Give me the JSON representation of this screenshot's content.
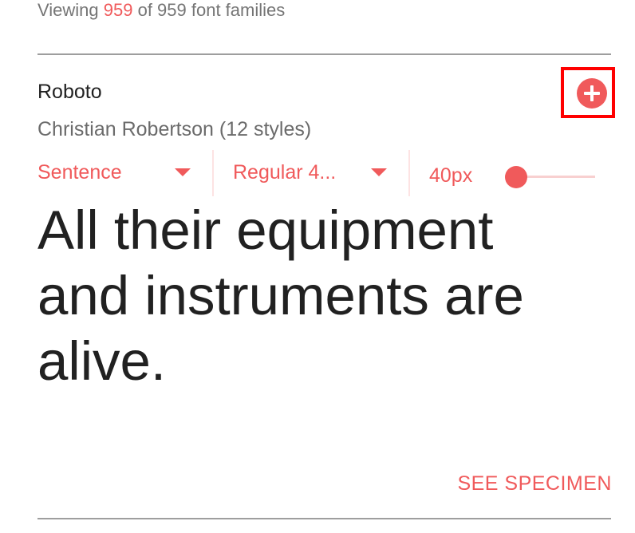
{
  "header": {
    "viewing_prefix": "Viewing ",
    "viewing_count": "959",
    "viewing_suffix": " of 959 font families"
  },
  "font_card": {
    "name": "Roboto",
    "designer": "Christian Robertson (12 styles)",
    "add_icon": "plus-circle-icon",
    "controls": {
      "text_type": "Sentence",
      "style": "Regular 4...",
      "size": "40px",
      "size_slider_fraction": 0.1
    },
    "preview_lines": [
      "All their equipment",
      "and instruments are",
      "alive."
    ],
    "see_specimen": "SEE SPECIMEN"
  },
  "colors": {
    "accent": "#f05a5b",
    "highlight": "#ff0000",
    "text": "#212121",
    "muted": "#757575"
  }
}
